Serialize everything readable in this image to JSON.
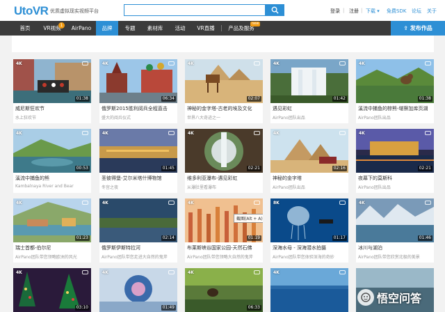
{
  "header": {
    "logo": "UtoVR",
    "tagline": "优质虚拟现实视频平台",
    "search_placeholder": "",
    "links": {
      "login": "登录",
      "divider": "|",
      "register": "注册",
      "download": "下载",
      "free_sdk": "免费SDK",
      "forum": "论坛",
      "about": "关于"
    }
  },
  "nav": {
    "items": [
      {
        "label": "首页"
      },
      {
        "label": "VR视频",
        "badge": "1"
      },
      {
        "label": "AirPano"
      },
      {
        "label": "品牌"
      },
      {
        "label": "专题"
      },
      {
        "label": "素材库"
      },
      {
        "label": "活动"
      },
      {
        "label": "VR直播"
      },
      {
        "label": "产品及服务",
        "new": "new"
      }
    ],
    "publish": "发布作品"
  },
  "videos": [
    {
      "title": "威尼斯狂欢节",
      "sub": "水上狂欢节",
      "duration": "01:38",
      "tag": "4K"
    },
    {
      "title": "俄罗斯2015胜利阅兵全程直击",
      "sub": "盛大的阅兵仪式",
      "duration": "06:34",
      "tag": "4K"
    },
    {
      "title": "神秘的金字塔-古老的埃及文化",
      "sub": "世界八大奇迹之一",
      "duration": "02:07",
      "tag": "4K"
    },
    {
      "title": "遇见彩虹",
      "sub": "AirPano团队出品",
      "duration": "01:42",
      "tag": "4K"
    },
    {
      "title": "溪流中捕鱼的棕熊-堪察加库页湖",
      "sub": "AirPano团队出品",
      "duration": "01:38",
      "tag": "4K"
    },
    {
      "title": "溪流中捕鱼的熊",
      "sub": "Kambalnaya River and Bear",
      "duration": "00:53",
      "tag": "4K"
    },
    {
      "title": "圣彼得堡-艾尔米塔什博物馆",
      "sub": "冬宫之夜",
      "duration": "01:45",
      "tag": "4K"
    },
    {
      "title": "维多利亚瀑布-遇见彩虹",
      "sub": "从瀑肚里看瀑布",
      "duration": "02:21",
      "tag": "4K"
    },
    {
      "title": "神秘的金字塔",
      "sub": "AirPano团队出品",
      "duration": "02:16",
      "tag": "4K"
    },
    {
      "title": "夜幕下的莫斯科",
      "sub": "AirPano团队出品",
      "duration": "02:21",
      "tag": "4K"
    },
    {
      "title": "瑞士首都-伯尔尼",
      "sub": "AirPano团队带您领略欧洲的风光",
      "duration": "01:23",
      "tag": "4K"
    },
    {
      "title": "俄罗斯伊斯特拉河",
      "sub": "AirPano团队带您走进大自然的鬼斧",
      "duration": "02:14",
      "tag": "4K"
    },
    {
      "title": "布莱斯峡谷国家公园-天然石佛",
      "sub": "AirPano团队带您领略大自然的鬼斧",
      "duration": "01:19",
      "tag": "4K",
      "tooltip": "截图(Alt + A)"
    },
    {
      "title": "深海水母 - 深海潜水拍摄",
      "sub": "AirPano团队带您体验深海的奇妙",
      "duration": "01:17",
      "tag": "8K"
    },
    {
      "title": "冰川与湖泊",
      "sub": "AirPano团队带您欣赏北极的美景",
      "duration": "01:46",
      "tag": "4K"
    },
    {
      "title": "",
      "sub": "",
      "duration": "03:10",
      "tag": "4K"
    },
    {
      "title": "",
      "sub": "",
      "duration": "01:49",
      "tag": "4K"
    },
    {
      "title": "",
      "sub": "",
      "duration": "06:33",
      "tag": "4K"
    },
    {
      "title": "",
      "sub": "",
      "duration": "",
      "tag": "4K"
    },
    {
      "title": "",
      "sub": "",
      "duration": "",
      "tag": ""
    }
  ],
  "watermark": "悟空问答",
  "colors": {
    "brand": "#2d8fd5",
    "nav_bg": "#3b3b3b",
    "badge": "#f39c12"
  }
}
